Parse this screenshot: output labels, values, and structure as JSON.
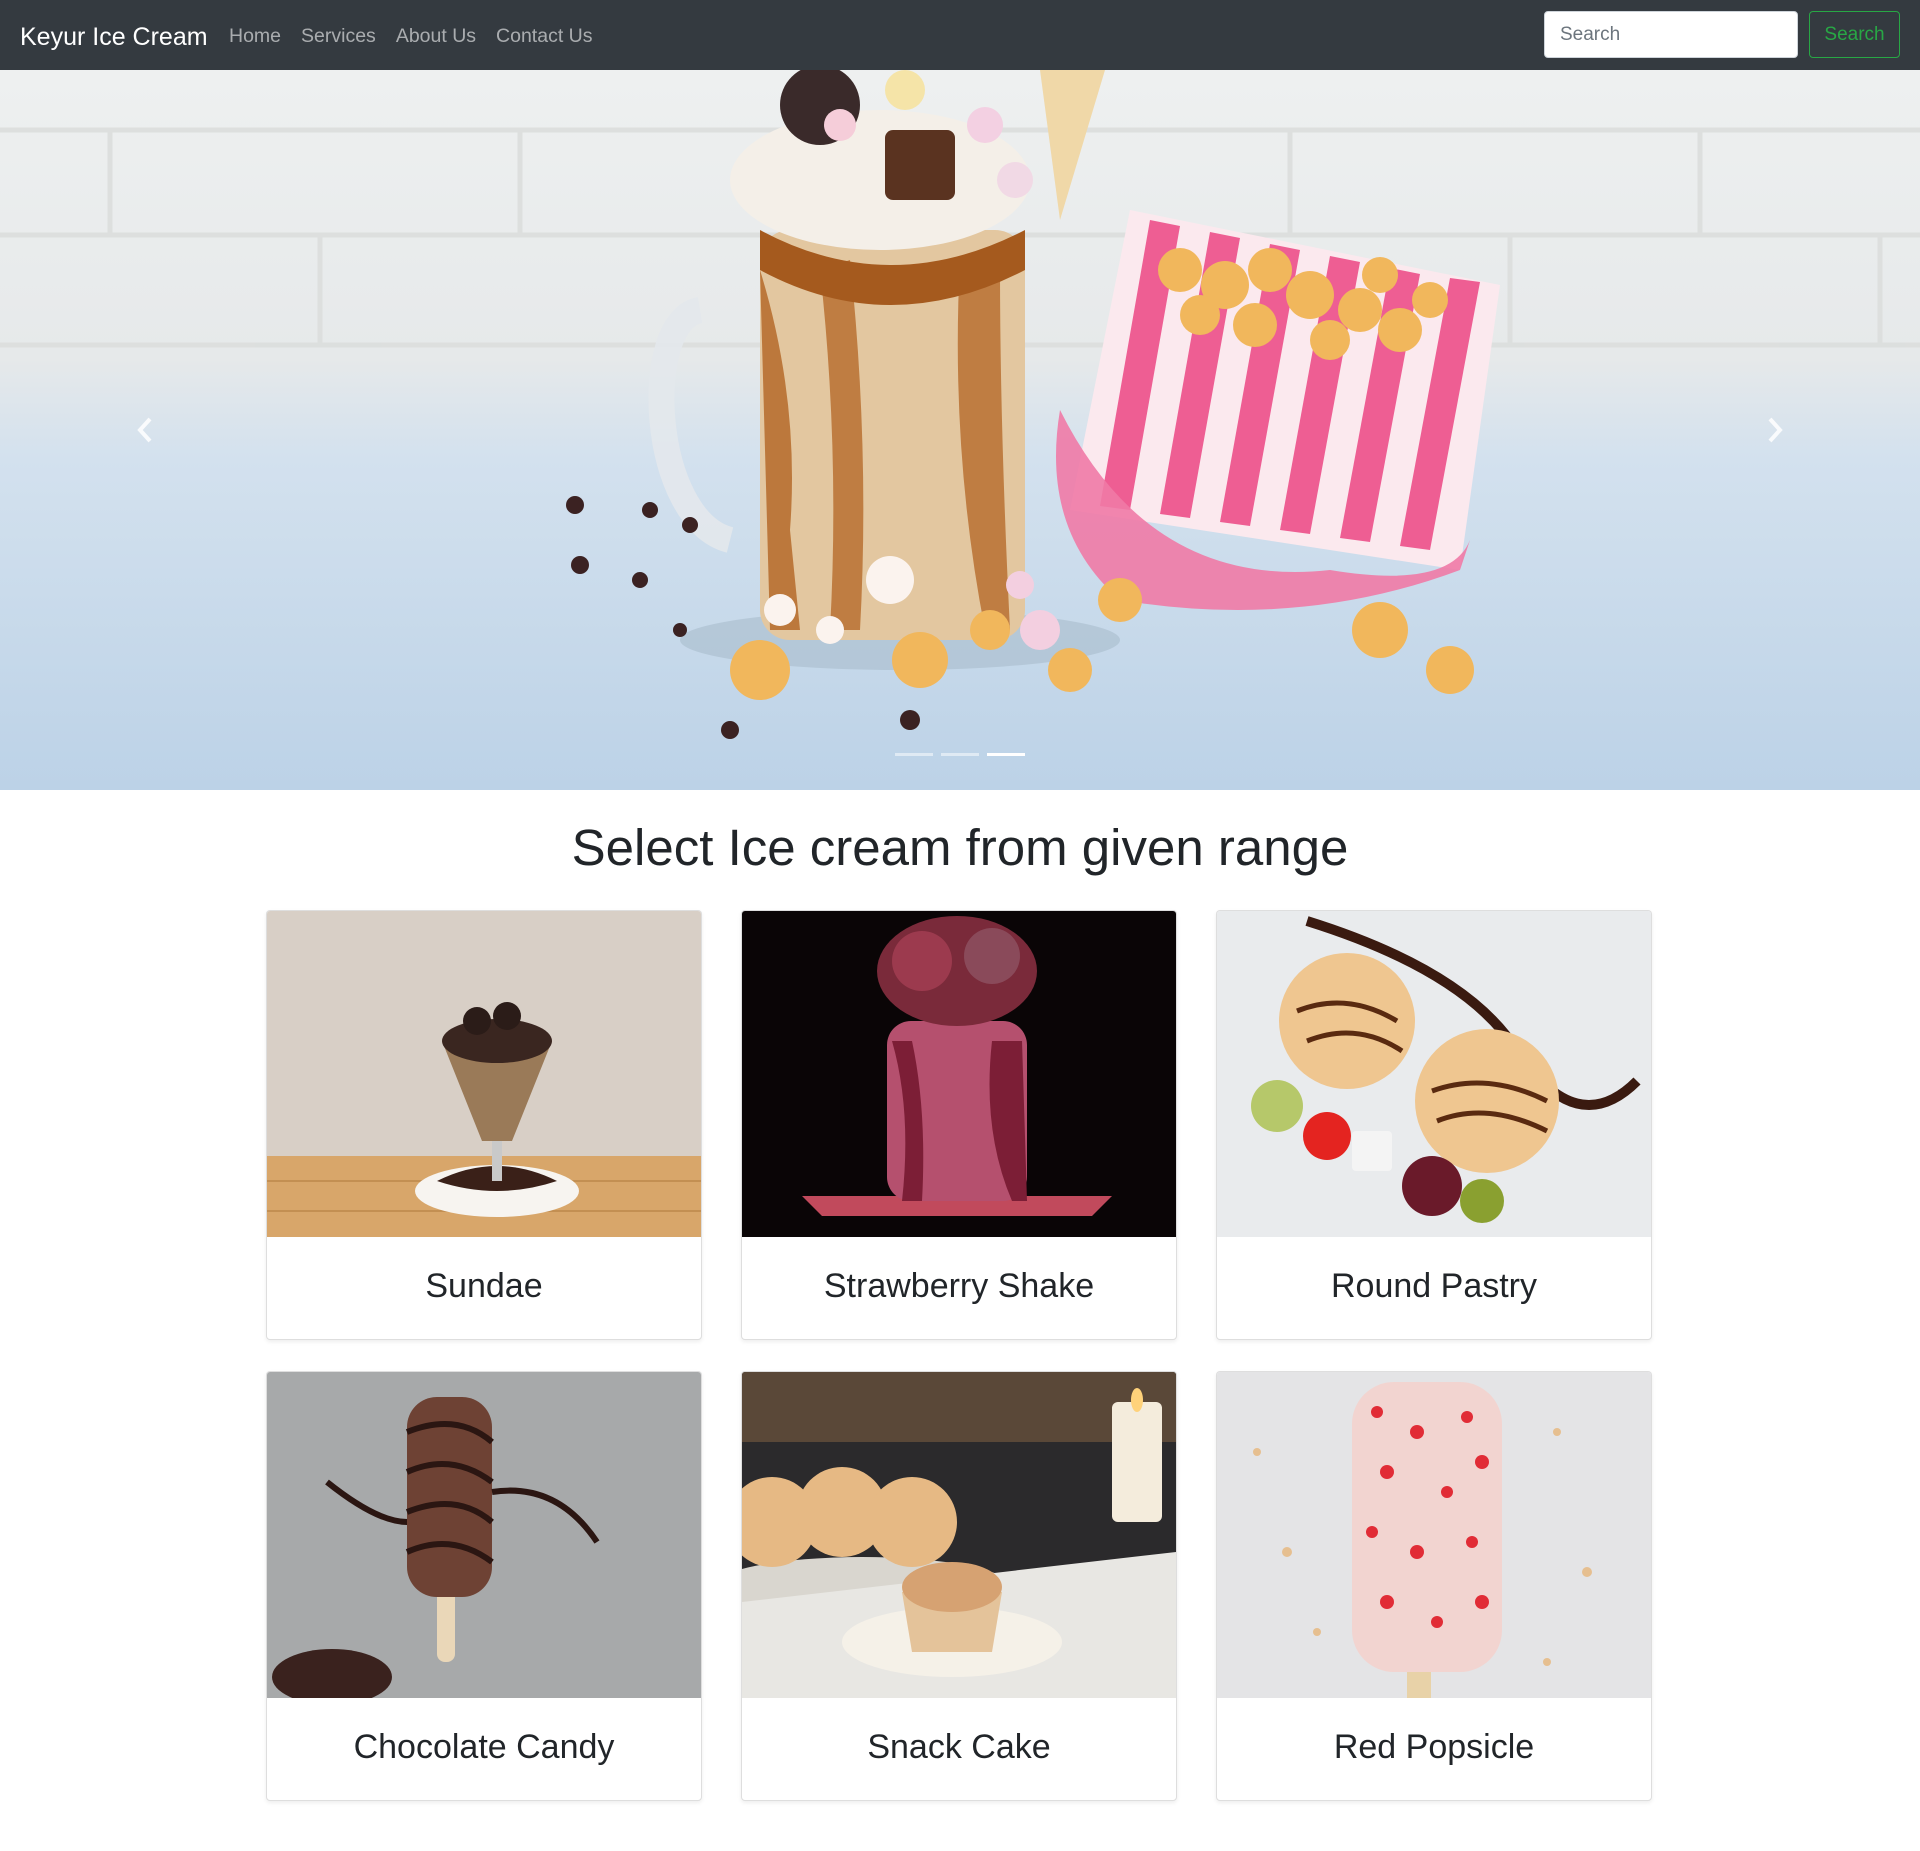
{
  "navbar": {
    "brand": "Keyur Ice Cream",
    "links": [
      "Home",
      "Services",
      "About Us",
      "Contact Us"
    ],
    "search_placeholder": "Search",
    "search_button": "Search"
  },
  "carousel": {
    "slide_count": 3,
    "active_index": 2,
    "prev_icon": "chevron-left-icon",
    "next_icon": "chevron-right-icon"
  },
  "section": {
    "title": "Select Ice cream from given range"
  },
  "products": [
    {
      "name": "Sundae"
    },
    {
      "name": "Strawberry Shake"
    },
    {
      "name": "Round Pastry"
    },
    {
      "name": "Chocolate Candy"
    },
    {
      "name": "Snack Cake"
    },
    {
      "name": "Red Popsicle"
    }
  ],
  "colors": {
    "navbar_bg": "#343a40",
    "search_button": "#28a745"
  }
}
